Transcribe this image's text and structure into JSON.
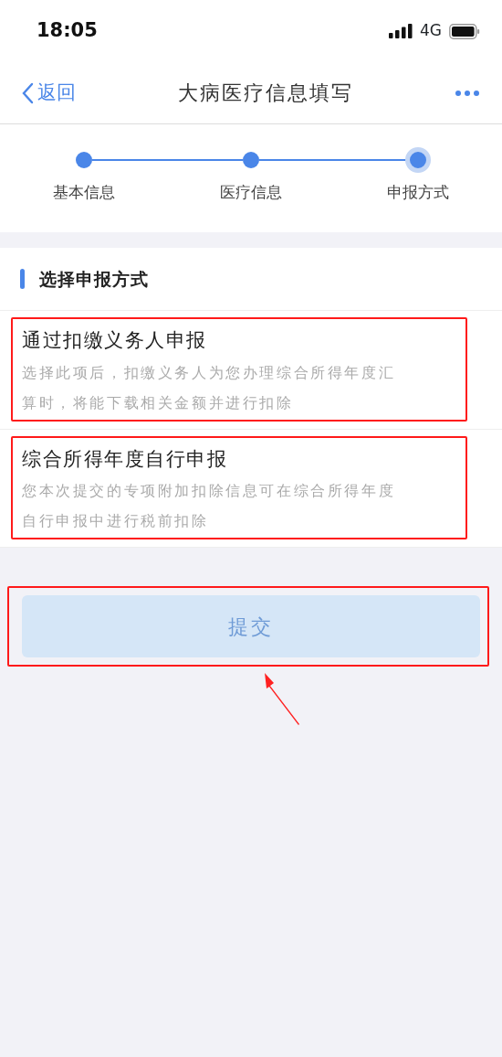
{
  "status_bar": {
    "time": "18:05",
    "network": "4G"
  },
  "nav": {
    "back": "返回",
    "title": "大病医疗信息填写"
  },
  "steps": [
    {
      "label": "基本信息",
      "selected": false
    },
    {
      "label": "医疗信息",
      "selected": false
    },
    {
      "label": "申报方式",
      "selected": true
    }
  ],
  "section": {
    "title": "选择申报方式"
  },
  "options": [
    {
      "title": "通过扣缴义务人申报",
      "description_lines": [
        "选择此项后，扣缴义务人为您办理综合所得年度汇",
        "算时，将能下载相关金额并进行扣除"
      ],
      "highlighted": true
    },
    {
      "title": "综合所得年度自行申报",
      "description_lines": [
        "您本次提交的专项附加扣除信息可在综合所得年度",
        "自行申报中进行税前扣除"
      ],
      "highlighted": true
    }
  ],
  "submit": {
    "label": "提交",
    "disabled": true,
    "highlighted": true
  }
}
